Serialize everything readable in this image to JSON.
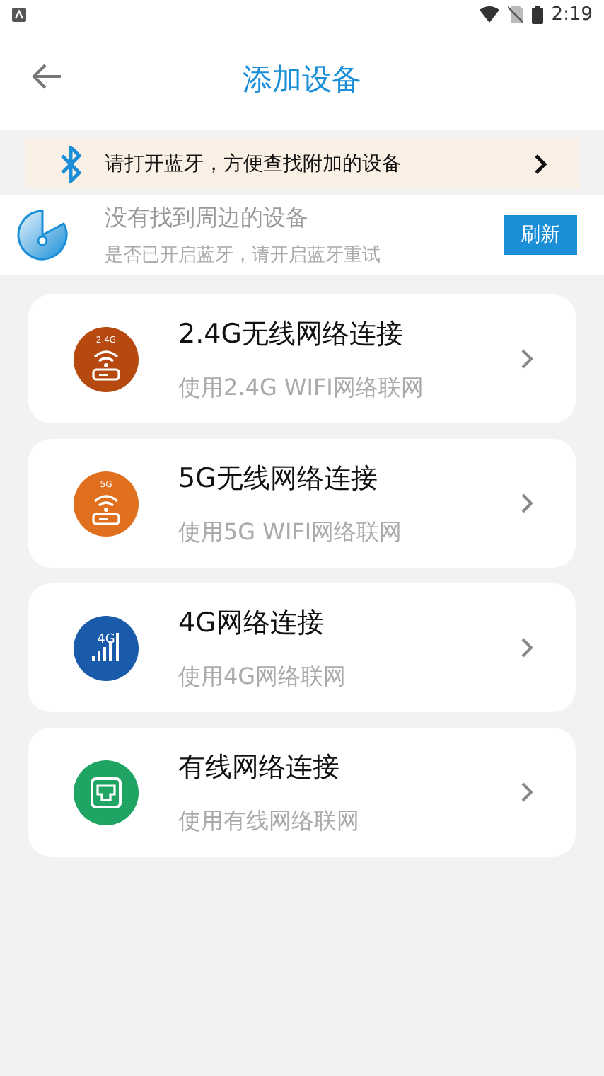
{
  "status_bar": {
    "time": "2:19"
  },
  "header": {
    "title": "添加设备"
  },
  "bluetooth_banner": {
    "text": "请打开蓝牙，方便查找附加的设备"
  },
  "scan": {
    "title": "没有找到周边的设备",
    "subtitle": "是否已开启蓝牙，请开启蓝牙重试",
    "button": "刷新"
  },
  "options": [
    {
      "kind": "wifi",
      "icon_label": "2.4G",
      "color": "#b5490f",
      "title": "2.4G无线网络连接",
      "subtitle": "使用2.4G WIFI网络联网"
    },
    {
      "kind": "wifi",
      "icon_label": "5G",
      "color": "#e0701e",
      "title": "5G无线网络连接",
      "subtitle": "使用5G WIFI网络联网"
    },
    {
      "kind": "cell",
      "icon_label": "4G",
      "color": "#1a5aab",
      "title": "4G网络连接",
      "subtitle": "使用4G网络联网"
    },
    {
      "kind": "ethernet",
      "color": "#1fa463",
      "title": "有线网络连接",
      "subtitle": "使用有线网络联网"
    }
  ]
}
